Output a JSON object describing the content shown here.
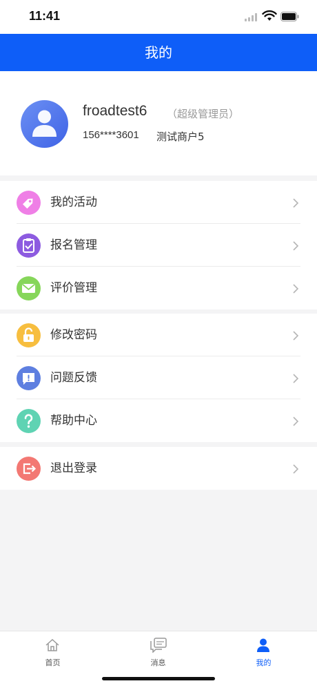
{
  "status_bar": {
    "time": "11:41"
  },
  "nav": {
    "title": "我的"
  },
  "profile": {
    "username": "froadtest6",
    "role": "（超级管理员）",
    "phone": "156****3601",
    "merchant": "测试商户5"
  },
  "menu_groups": [
    {
      "items": [
        {
          "label": "我的活动",
          "icon": "tag-icon",
          "color": "#ef7fe6"
        },
        {
          "label": "报名管理",
          "icon": "clipboard-check-icon",
          "color": "#8d5be0"
        },
        {
          "label": "评价管理",
          "icon": "envelope-icon",
          "color": "#86d65a"
        }
      ]
    },
    {
      "items": [
        {
          "label": "修改密码",
          "icon": "lock-icon",
          "color": "#f7be3f"
        },
        {
          "label": "问题反馈",
          "icon": "feedback-icon",
          "color": "#5e7fe0"
        },
        {
          "label": "帮助中心",
          "icon": "question-icon",
          "color": "#5fd3b3"
        }
      ]
    },
    {
      "items": [
        {
          "label": "退出登录",
          "icon": "logout-icon",
          "color": "#f37873"
        }
      ]
    }
  ],
  "tabs": [
    {
      "label": "首页",
      "icon": "home-icon",
      "active": false
    },
    {
      "label": "消息",
      "icon": "message-icon",
      "active": false
    },
    {
      "label": "我的",
      "icon": "user-icon",
      "active": true
    }
  ],
  "colors": {
    "primary": "#0e5ef8",
    "background": "#f4f4f5"
  }
}
